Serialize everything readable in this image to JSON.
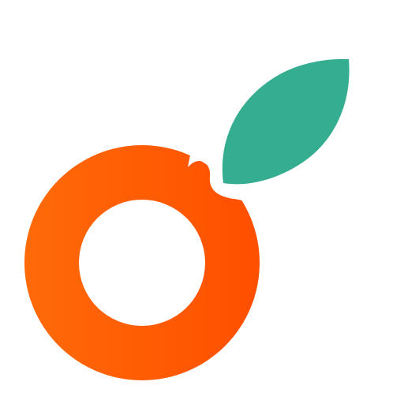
{
  "logo": {
    "description_name": "orange-fruit-logo",
    "colors": {
      "background": "#ffffff",
      "fruit_orange_light": "#ff6a08",
      "fruit_orange_dark": "#ff4f00",
      "leaf_green": "#35ad90"
    },
    "icon_parts": [
      "fruit-ring-icon",
      "leaf-icon"
    ]
  }
}
